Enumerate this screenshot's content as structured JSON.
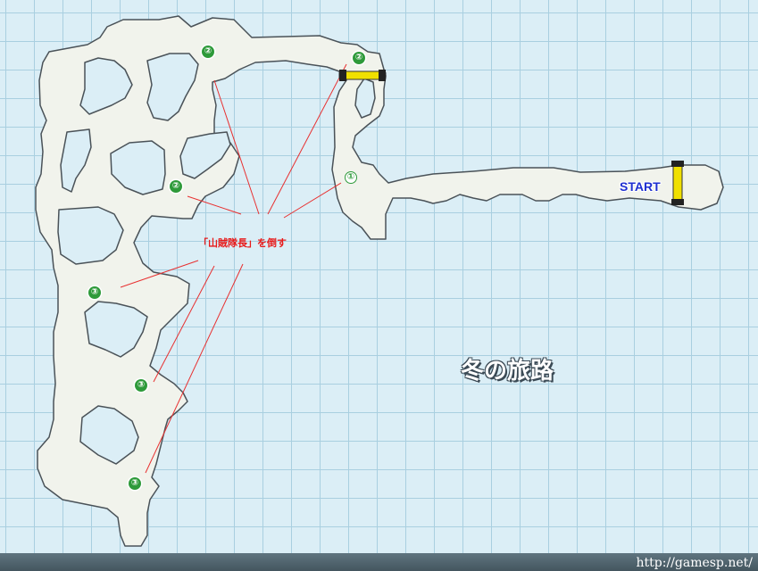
{
  "map": {
    "title": "冬の旅路",
    "start_label": "START",
    "boss_label": "「山賊隊長」を倒す",
    "footer_url": "http://gamesp.net/",
    "markers": {
      "m1": "①",
      "m2_top": "②",
      "m2_right": "②",
      "m2_mid": "②",
      "m3_a": "③",
      "m3_b": "③",
      "m3_c": "③"
    },
    "colors": {
      "path_fill": "#f1f3ec",
      "path_stroke": "#4a5258",
      "grid_line": "#a9cfe0",
      "background": "#dbeef6",
      "marker": "#2e9a3a",
      "boss_text": "#e81a1a",
      "start_text": "#1e2fd0",
      "gate": "#f0e000"
    }
  }
}
